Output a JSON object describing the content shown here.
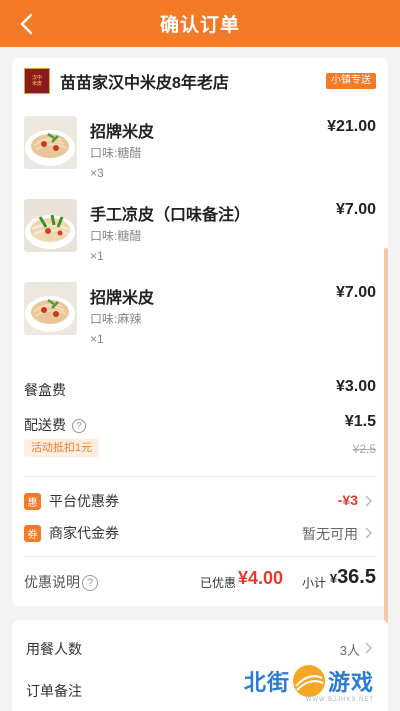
{
  "header": {
    "title": "确认订单"
  },
  "shop": {
    "name": "苗苗家汉中米皮8年老店",
    "delivery_badge": "小镇专送",
    "logo_text": "汉中米皮"
  },
  "items": [
    {
      "name": "招牌米皮",
      "taste": "口味:糖醋",
      "qty": "×3",
      "price": "¥21.00"
    },
    {
      "name": "手工凉皮（口味备注）",
      "taste": "口味:糖醋",
      "qty": "×1",
      "price": "¥7.00"
    },
    {
      "name": "招牌米皮",
      "taste": "口味:麻辣",
      "qty": "×1",
      "price": "¥7.00"
    }
  ],
  "fees": {
    "box_label": "餐盒费",
    "box_value": "¥3.00",
    "delivery_label": "配送费",
    "delivery_value": "¥1.5",
    "promo_tag": "活动抵扣1元",
    "old_price": "¥2.5"
  },
  "coupons": {
    "platform_icon": "惠",
    "platform_label": "平台优惠券",
    "platform_value": "-¥3",
    "merchant_icon": "券",
    "merchant_label": "商家代金券",
    "merchant_value": "暂无可用"
  },
  "summary": {
    "label": "优惠说明",
    "saved_label": "已优惠",
    "saved_value": "¥4.00",
    "subtotal_label": "小计",
    "subtotal_yen": "¥",
    "subtotal_value": "36.5"
  },
  "bottom": {
    "diners_label": "用餐人数",
    "diners_value": "3人",
    "note_label": "订单备注"
  },
  "watermark": {
    "left": "北街",
    "right": "游戏",
    "sub": "WWW.BJJHKS.NET"
  },
  "colors": {
    "accent": "#f57a28",
    "price_red": "#e43b2c"
  }
}
